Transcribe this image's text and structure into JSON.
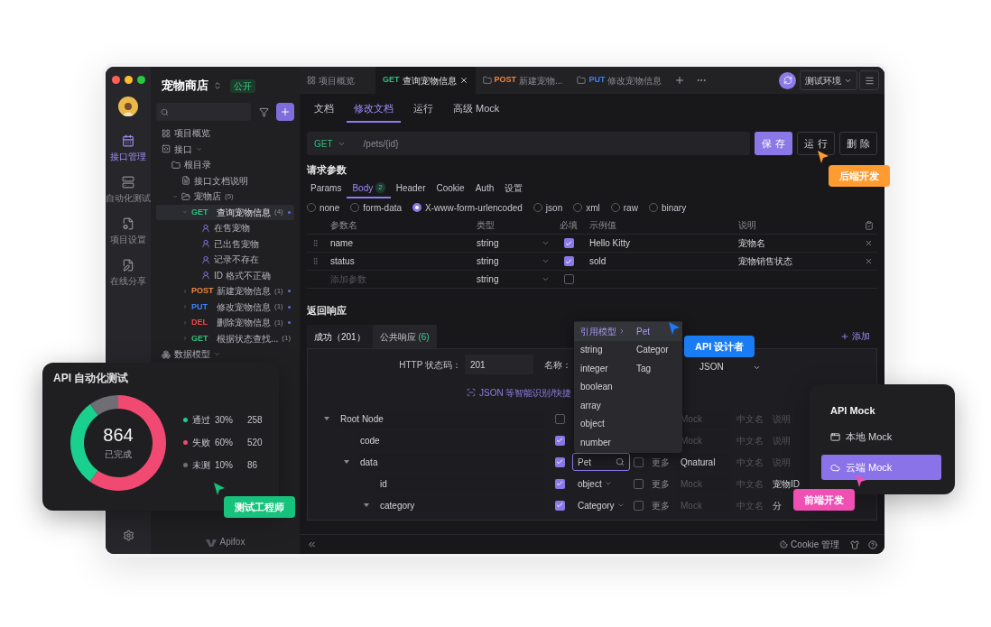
{
  "window": {
    "project": "宠物商店",
    "visibility": "公开",
    "brand": "Apifox"
  },
  "rail": [
    {
      "label": "接口管理",
      "kind": "api",
      "selected": true
    },
    {
      "label": "自动化测试",
      "kind": "test",
      "selected": false
    },
    {
      "label": "项目设置",
      "kind": "settings",
      "selected": false
    },
    {
      "label": "在线分享",
      "kind": "share",
      "selected": false
    }
  ],
  "sidebar": {
    "tree": [
      {
        "label": "项目概览",
        "kind": "overview",
        "selected": false
      },
      {
        "label": "接口",
        "kind": "api-section",
        "selected": false,
        "children": [
          {
            "label": "根目录",
            "kind": "folder",
            "selected": false,
            "children": [
              {
                "label": "接口文档说明",
                "kind": "doc",
                "selected": false
              },
              {
                "label": "宠物店",
                "count": "(5)",
                "kind": "folder",
                "expanded": true,
                "selected": false,
                "children": [
                  {
                    "method": "GET",
                    "color": "#2ebf7d",
                    "label": "查询宠物信息",
                    "count": "(4)",
                    "kind": "api",
                    "expanded": true,
                    "selected": true,
                    "children": [
                      {
                        "label": "在售宠物",
                        "kind": "case",
                        "selected": false
                      },
                      {
                        "label": "已出售宠物",
                        "kind": "case",
                        "selected": false
                      },
                      {
                        "label": "记录不存在",
                        "kind": "case",
                        "selected": false
                      },
                      {
                        "label": "ID 格式不正确",
                        "kind": "case",
                        "selected": false
                      }
                    ]
                  },
                  {
                    "method": "POST",
                    "color": "#f0843c",
                    "label": "新建宠物信息",
                    "count": "(1)",
                    "kind": "api",
                    "expanded": false,
                    "selected": false
                  },
                  {
                    "method": "PUT",
                    "color": "#3b82f6",
                    "label": "修改宠物信息",
                    "count": "(1)",
                    "kind": "api",
                    "expanded": false,
                    "selected": false
                  },
                  {
                    "method": "DEL",
                    "color": "#ef4444",
                    "label": "删除宠物信息",
                    "count": "(1)",
                    "kind": "api",
                    "expanded": false,
                    "selected": false
                  },
                  {
                    "method": "GET",
                    "color": "#2ebf7d",
                    "label": "根据状态查找...",
                    "count": "(1)",
                    "kind": "api",
                    "expanded": false,
                    "selected": false
                  }
                ]
              }
            ]
          }
        ]
      },
      {
        "label": "数据模型",
        "kind": "model-section",
        "selected": false
      }
    ]
  },
  "tabs": [
    {
      "label": "项目概览",
      "kind": "overview",
      "selected": false
    },
    {
      "method": "GET",
      "color": "#2ebf7d",
      "label": "查询宠物信息",
      "kind": "api",
      "selected": true
    },
    {
      "method": "POST",
      "color": "#f0843c",
      "label": "新建宠物...",
      "kind": "folder",
      "selected": false
    },
    {
      "method": "PUT",
      "color": "#3b82f6",
      "label": "修改宠物信息",
      "kind": "folder",
      "selected": false
    }
  ],
  "environment": "测试环境",
  "doc_tabs": [
    {
      "label": "文档",
      "selected": false
    },
    {
      "label": "修改文档",
      "selected": true
    },
    {
      "label": "运行",
      "selected": false
    },
    {
      "label": "高级 Mock",
      "selected": false
    }
  ],
  "request": {
    "method": "GET",
    "path": "/pets/{id}",
    "buttons": [
      {
        "label": "保 存",
        "kind": "primary"
      },
      {
        "label": "运 行",
        "kind": "default"
      },
      {
        "label": "删 除",
        "kind": "default"
      }
    ]
  },
  "params": {
    "title": "请求参数",
    "tabs": [
      {
        "label": "Params",
        "selected": false
      },
      {
        "label": "Body",
        "badge": "2",
        "selected": true
      },
      {
        "label": "Header",
        "selected": false
      },
      {
        "label": "Cookie",
        "selected": false
      },
      {
        "label": "Auth",
        "selected": false
      },
      {
        "label": "设置",
        "selected": false
      }
    ],
    "body_types": [
      {
        "label": "none",
        "selected": false
      },
      {
        "label": "form-data",
        "selected": false
      },
      {
        "label": "X-www-form-urlencoded",
        "selected": true
      },
      {
        "label": "json",
        "selected": false
      },
      {
        "label": "xml",
        "selected": false
      },
      {
        "label": "raw",
        "selected": false
      },
      {
        "label": "binary",
        "selected": false
      }
    ],
    "columns": [
      "参数名",
      "类型",
      "必填",
      "示例值",
      "说明"
    ],
    "rows": [
      {
        "name": {
          "value": "name"
        },
        "type": "string",
        "required": true,
        "example": {
          "value": "Hello Kitty"
        },
        "description": {
          "value": "宠物名"
        }
      },
      {
        "name": {
          "value": "status"
        },
        "type": "string",
        "required": true,
        "example": {
          "value": "sold"
        },
        "description": {
          "value": "宠物销售状态"
        }
      },
      {
        "name": {
          "placeholder": "添加参数"
        },
        "type": "string",
        "required": false
      }
    ]
  },
  "response": {
    "title": "返回响应",
    "tabs": [
      {
        "label": "成功（201）",
        "selected": true
      },
      {
        "label": "公共响应",
        "count": "(6)",
        "selected": false
      }
    ],
    "add": "添加",
    "status_label": "HTTP 状态码：",
    "status": "201",
    "name_label": "名称：",
    "format": "JSON",
    "hint": "JSON 等智能识别/快捷",
    "schema": [
      {
        "name": "Root Node",
        "expanded": true,
        "required": false,
        "mock": {
          "placeholder": "Mock"
        },
        "cn": {
          "placeholder": "中文名"
        },
        "desc": {
          "placeholder": "说明"
        },
        "children": [
          {
            "name": "code",
            "required": true,
            "mock": {
              "placeholder": "Mock"
            },
            "cn": {
              "placeholder": "中文名"
            },
            "desc": {
              "placeholder": "说明"
            }
          },
          {
            "name": "data",
            "expanded": true,
            "required": true,
            "type": {
              "value": "Pet",
              "kind": "search"
            },
            "nullable": false,
            "more": "更多",
            "mock": {
              "value": "Qnatural"
            },
            "cn": {
              "placeholder": "中文名"
            },
            "desc": {
              "placeholder": "说明"
            },
            "children": [
              {
                "name": "id",
                "required": true,
                "type": {
                  "value": "object",
                  "kind": "select"
                },
                "nullable": false,
                "more": "更多",
                "mock": {
                  "placeholder": "Mock"
                },
                "cn": {
                  "placeholder": "中文名"
                },
                "desc": {
                  "value": "宠物ID"
                }
              },
              {
                "name": "category",
                "expanded": true,
                "required": true,
                "type": {
                  "value": "Category",
                  "kind": "select"
                },
                "nullable": false,
                "more": "更多",
                "mock": {
                  "placeholder": "Mock"
                },
                "cn": {
                  "placeholder": "中文名"
                },
                "desc": {
                  "value": "分"
                }
              }
            ]
          }
        ]
      }
    ]
  },
  "footer": {
    "cookie": "Cookie 管理"
  },
  "type_menu": {
    "items": [
      {
        "label": "引用模型",
        "kind": "submenu",
        "selected": true
      },
      {
        "label": "string",
        "kind": "type",
        "selected": false
      },
      {
        "label": "integer",
        "kind": "type",
        "selected": false
      },
      {
        "label": "boolean",
        "kind": "type",
        "selected": false
      },
      {
        "label": "array",
        "kind": "type",
        "selected": false
      },
      {
        "label": "object",
        "kind": "type",
        "selected": false
      },
      {
        "label": "number",
        "kind": "type",
        "selected": false
      }
    ],
    "submenu": [
      {
        "label": "Pet",
        "selected": true
      },
      {
        "label": "Categor",
        "selected": false
      },
      {
        "label": "Tag",
        "selected": false
      }
    ]
  },
  "test_card": {
    "title": "API 自动化测试",
    "total": "864",
    "caption": "已完成",
    "chart_data": {
      "type": "donut",
      "values": [
        30,
        60,
        10
      ]
    },
    "legend": [
      {
        "label": "通过",
        "percent": "30%",
        "count": "258",
        "color": "#19d08f"
      },
      {
        "label": "失败",
        "percent": "60%",
        "count": "520",
        "color": "#f04a72"
      },
      {
        "label": "未测",
        "percent": "10%",
        "count": "86",
        "color": "#6e6e74"
      }
    ]
  },
  "mock_card": {
    "title": "API Mock",
    "items": [
      {
        "label": "本地 Mock",
        "kind": "local",
        "selected": false
      },
      {
        "label": "云端 Mock",
        "kind": "cloud",
        "selected": true
      }
    ]
  },
  "role_tags": [
    {
      "label": "后端开发",
      "color": "#ff9b30"
    },
    {
      "label": "API 设计者",
      "color": "#1a7cf5"
    },
    {
      "label": "前端开发",
      "color": "#f04fb4"
    },
    {
      "label": "测试工程师",
      "color": "#17c27c"
    }
  ]
}
